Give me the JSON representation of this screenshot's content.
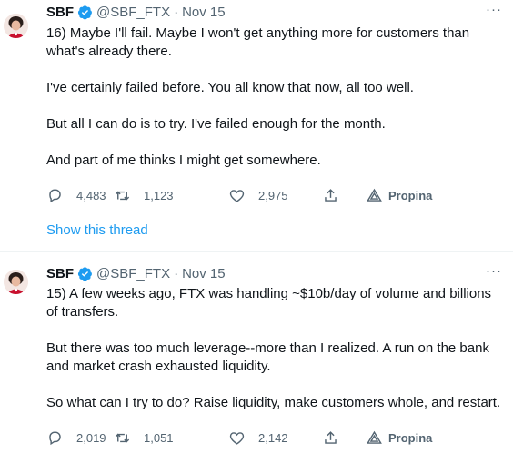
{
  "tweets": [
    {
      "name": "SBF",
      "handle": "@SBF_FTX",
      "separator": "·",
      "date": "Nov 15",
      "more": "···",
      "paragraphs": [
        "16) Maybe I'll fail.  Maybe I won't get anything more for customers than what's already there.",
        "I've certainly failed before.  You all know that now, all too well.",
        "But all I can do is to try.  I've failed enough for the month.",
        "And part of me thinks I might get somewhere."
      ],
      "replies": "4,483",
      "retweets": "1,123",
      "likes": "2,975",
      "tip_label": "Propina",
      "show_thread": "Show this thread"
    },
    {
      "name": "SBF",
      "handle": "@SBF_FTX",
      "separator": "·",
      "date": "Nov 15",
      "more": "···",
      "paragraphs": [
        "15) A few weeks ago, FTX was handling ~$10b/day of volume and billions of transfers.",
        "But there was too much leverage--more than I realized.  A run on the bank and market crash exhausted liquidity.",
        "So what can I try to do?  Raise liquidity, make customers whole, and restart."
      ],
      "replies": "2,019",
      "retweets": "1,051",
      "likes": "2,142",
      "tip_label": "Propina"
    }
  ],
  "colors": {
    "text": "#0f1419",
    "secondary": "#536471",
    "link": "#1d9bf0",
    "verified": "#1d9bf0"
  },
  "icons": [
    "avatar",
    "verified-badge-icon",
    "more-icon",
    "reply-icon",
    "retweet-icon",
    "like-icon",
    "share-icon",
    "tip-icon"
  ]
}
